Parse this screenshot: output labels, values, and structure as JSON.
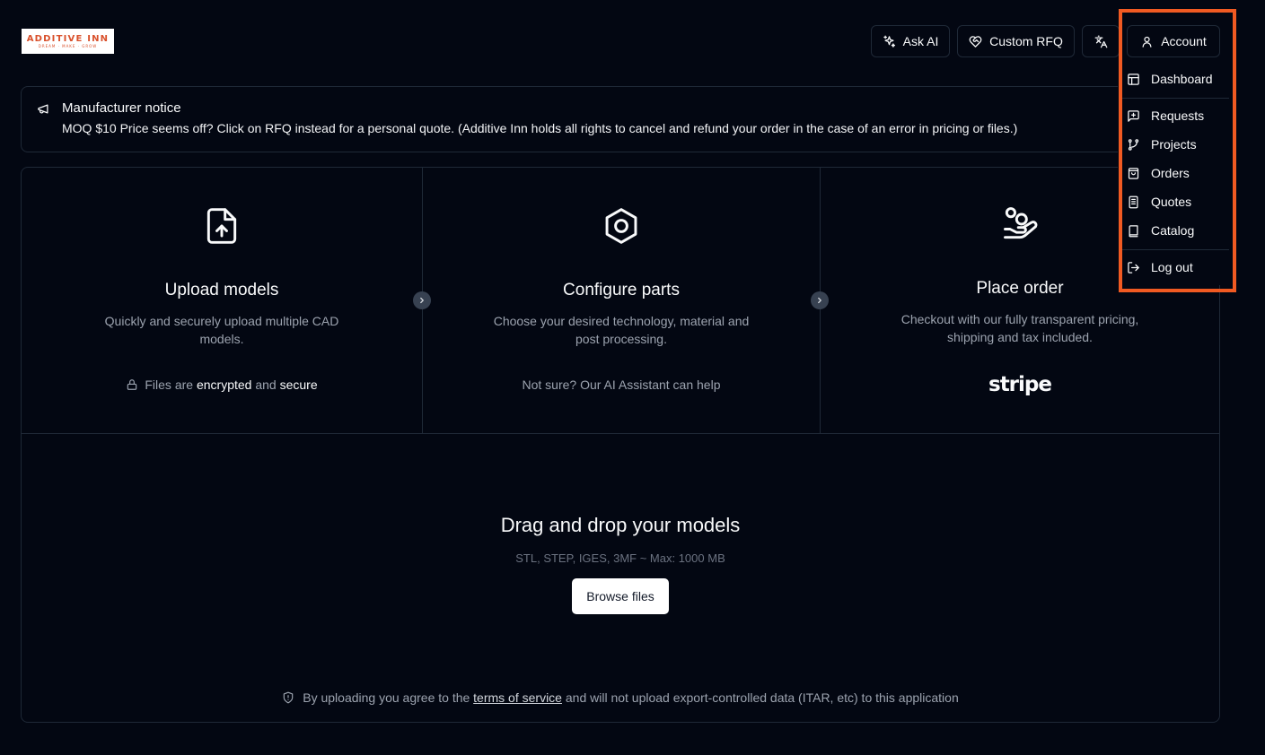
{
  "brand": {
    "logo_text": "ADDITIVE INN",
    "logo_tagline": "DREAM · MAKE · GROW",
    "accent": "#f15a22"
  },
  "header": {
    "ask_ai": "Ask AI",
    "custom_rfq": "Custom RFQ",
    "account": "Account",
    "icons": [
      "sparkles-icon",
      "heart-handshake-icon",
      "translate-icon",
      "user-icon"
    ]
  },
  "notice": {
    "title": "Manufacturer notice",
    "text": "MOQ $10 Price seems off? Click on RFQ instead for a personal quote. (Additive Inn holds all rights to cancel and refund your order in the case of an error in pricing or files.)"
  },
  "steps": [
    {
      "title": "Upload models",
      "desc": "Quickly and securely upload multiple CAD models.",
      "foot_pre": "Files are",
      "foot_b1": "encrypted",
      "foot_mid": "and",
      "foot_b2": "secure"
    },
    {
      "title": "Configure parts",
      "desc": "Choose your desired technology, material and post processing.",
      "foot": "Not sure? Our AI Assistant can help"
    },
    {
      "title": "Place order",
      "desc": "Checkout with our fully transparent pricing, shipping and tax included.",
      "foot": "stripe"
    }
  ],
  "dropzone": {
    "title": "Drag and drop your models",
    "formats": "STL, STEP, IGES, 3MF ~ Max: 1000 MB",
    "browse": "Browse files",
    "legal_pre": "By uploading you agree to the",
    "legal_link": "terms of service",
    "legal_post": "and will not upload export-controlled data (ITAR, etc) to this application"
  },
  "account_menu": {
    "items": [
      "Dashboard",
      "Requests",
      "Projects",
      "Orders",
      "Quotes",
      "Catalog",
      "Log out"
    ]
  }
}
